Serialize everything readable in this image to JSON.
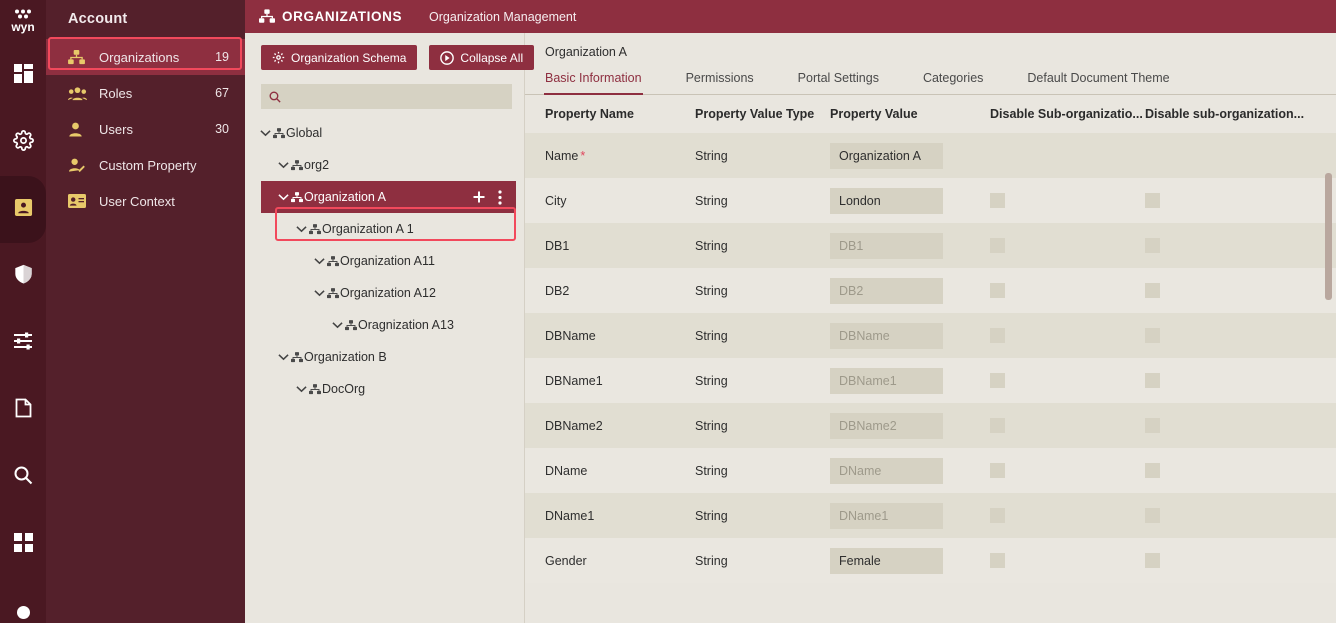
{
  "rail": {
    "logo": "wyn",
    "items": [
      {
        "name": "dashboard-icon",
        "active": false
      },
      {
        "name": "gear-icon",
        "active": false
      },
      {
        "name": "id-badge-icon",
        "active": true
      },
      {
        "name": "shield-icon",
        "active": false
      },
      {
        "name": "sliders-icon",
        "active": false
      },
      {
        "name": "document-icon",
        "active": false
      },
      {
        "name": "search-icon",
        "active": false
      },
      {
        "name": "apps-grid-icon",
        "active": false
      }
    ]
  },
  "sidebar": {
    "title": "Account",
    "items": [
      {
        "label": "Organizations",
        "count": "19",
        "icon": "org-chart-icon",
        "highlighted": true
      },
      {
        "label": "Roles",
        "count": "67",
        "icon": "group-icon",
        "highlighted": false
      },
      {
        "label": "Users",
        "count": "30",
        "icon": "user-icon",
        "highlighted": false
      },
      {
        "label": "Custom Property",
        "count": "",
        "icon": "user-edit-icon",
        "highlighted": false
      },
      {
        "label": "User Context",
        "count": "",
        "icon": "id-card-icon",
        "highlighted": false
      }
    ]
  },
  "topbar": {
    "title": "ORGANIZATIONS",
    "subtitle": "Organization Management"
  },
  "tree_panel": {
    "schema_button": "Organization Schema",
    "collapse_button": "Collapse All",
    "search": {
      "value": "",
      "placeholder": ""
    },
    "nodes": [
      {
        "label": "Global",
        "depth": 0,
        "selected": false
      },
      {
        "label": "org2",
        "depth": 1,
        "selected": false
      },
      {
        "label": "Organization A",
        "depth": 1,
        "selected": true
      },
      {
        "label": "Organization A 1",
        "depth": 2,
        "selected": false
      },
      {
        "label": "Organization A11",
        "depth": 3,
        "selected": false
      },
      {
        "label": "Organization A12",
        "depth": 3,
        "selected": false
      },
      {
        "label": "Oragnization A13",
        "depth": 4,
        "selected": false
      },
      {
        "label": "Organization B",
        "depth": 1,
        "selected": false
      },
      {
        "label": "DocOrg",
        "depth": 2,
        "selected": false
      }
    ]
  },
  "detail": {
    "title": "Organization A",
    "tabs": [
      {
        "label": "Basic Information",
        "active": true
      },
      {
        "label": "Permissions",
        "active": false
      },
      {
        "label": "Portal Settings",
        "active": false
      },
      {
        "label": "Categories",
        "active": false
      },
      {
        "label": "Default Document Theme",
        "active": false
      }
    ],
    "columns": [
      "Property Name",
      "Property Value Type",
      "Property Value",
      "Disable Sub-organizatio...",
      "Disable sub-organization..."
    ],
    "rows": [
      {
        "name": "Name",
        "required": true,
        "type": "String",
        "value": "Organization A",
        "is_placeholder": false,
        "checkboxes": false
      },
      {
        "name": "City",
        "required": false,
        "type": "String",
        "value": "London",
        "is_placeholder": false,
        "checkboxes": true
      },
      {
        "name": "DB1",
        "required": false,
        "type": "String",
        "value": "DB1",
        "is_placeholder": true,
        "checkboxes": true
      },
      {
        "name": "DB2",
        "required": false,
        "type": "String",
        "value": "DB2",
        "is_placeholder": true,
        "checkboxes": true
      },
      {
        "name": "DBName",
        "required": false,
        "type": "String",
        "value": "DBName",
        "is_placeholder": true,
        "checkboxes": true
      },
      {
        "name": "DBName1",
        "required": false,
        "type": "String",
        "value": "DBName1",
        "is_placeholder": true,
        "checkboxes": true
      },
      {
        "name": "DBName2",
        "required": false,
        "type": "String",
        "value": "DBName2",
        "is_placeholder": true,
        "checkboxes": true
      },
      {
        "name": "DName",
        "required": false,
        "type": "String",
        "value": "DName",
        "is_placeholder": true,
        "checkboxes": true
      },
      {
        "name": "DName1",
        "required": false,
        "type": "String",
        "value": "DName1",
        "is_placeholder": true,
        "checkboxes": true
      },
      {
        "name": "Gender",
        "required": false,
        "type": "String",
        "value": "Female",
        "is_placeholder": false,
        "checkboxes": true
      }
    ]
  },
  "colors": {
    "rail_bg": "#4A1822",
    "sidebar_bg": "#54202B",
    "accent_maroon": "#8E2F40",
    "highlight_red": "#F2495C",
    "icon_gold": "#E8C96A",
    "content_bg": "#E9E6DF",
    "row_odd": "#E1DED2",
    "field_bg": "#D6D2C3"
  }
}
